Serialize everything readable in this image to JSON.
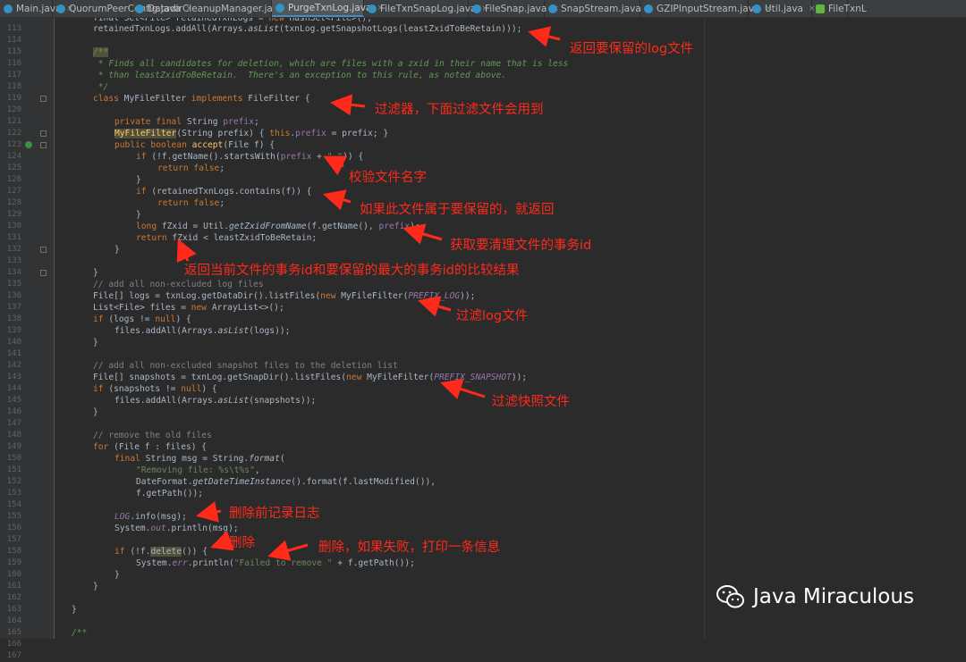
{
  "tabs": [
    {
      "label": "Main.java",
      "active": false,
      "icon": "class-icon"
    },
    {
      "label": "QuorumPeerConfig.java",
      "active": false,
      "icon": "class-icon"
    },
    {
      "label": "DatadirCleanupManager.java",
      "active": false,
      "icon": "class-icon"
    },
    {
      "label": "PurgeTxnLog.java",
      "active": true,
      "icon": "class-icon"
    },
    {
      "label": "FileTxnSnapLog.java",
      "active": false,
      "icon": "class-icon"
    },
    {
      "label": "FileSnap.java",
      "active": false,
      "icon": "class-icon"
    },
    {
      "label": "SnapStream.java",
      "active": false,
      "icon": "class-icon"
    },
    {
      "label": "GZIPInputStream.java",
      "active": false,
      "icon": "class-icon"
    },
    {
      "label": "Util.java",
      "active": false,
      "icon": "class-icon"
    },
    {
      "label": "FileTxnL",
      "active": false,
      "icon": "interface-icon"
    }
  ],
  "tab_close": "×",
  "line_numbers": [
    "113",
    "114",
    "115",
    "116",
    "117",
    "118",
    "119",
    "120",
    "121",
    "122",
    "123",
    "124",
    "125",
    "126",
    "127",
    "128",
    "129",
    "130",
    "131",
    "132",
    "133",
    "134",
    "135",
    "136",
    "137",
    "138",
    "139",
    "140",
    "141",
    "142",
    "143",
    "144",
    "145",
    "146",
    "147",
    "148",
    "149",
    "150",
    "151",
    "152",
    "153",
    "154",
    "155",
    "156",
    "157",
    "158",
    "159",
    "160",
    "161",
    "162",
    "163",
    "164",
    "165",
    "166",
    "167"
  ],
  "annotations": {
    "a1": "返回要保留的log文件",
    "a2": "过滤器，下面过滤文件会用到",
    "a3": "校验文件名字",
    "a4": "如果此文件属于要保留的，就返回",
    "a5": "获取要清理文件的事务id",
    "a6": "返回当前文件的事务id和要保留的最大的事务id的比较结果",
    "a7": "过滤log文件",
    "a8": "过滤快照文件",
    "a9": "删除前记录日志",
    "a10": "删除",
    "a11": "删除，如果失败，打印一条信息"
  },
  "watermark": {
    "text": "Java Miraculous",
    "icon": "wechat-icon"
  },
  "colors": {
    "annotation": "#ff2a1a",
    "editor_bg": "#2b2b2b",
    "keyword": "#cc7832",
    "string": "#6a8759",
    "comment": "#808080",
    "method": "#ffc66d"
  }
}
